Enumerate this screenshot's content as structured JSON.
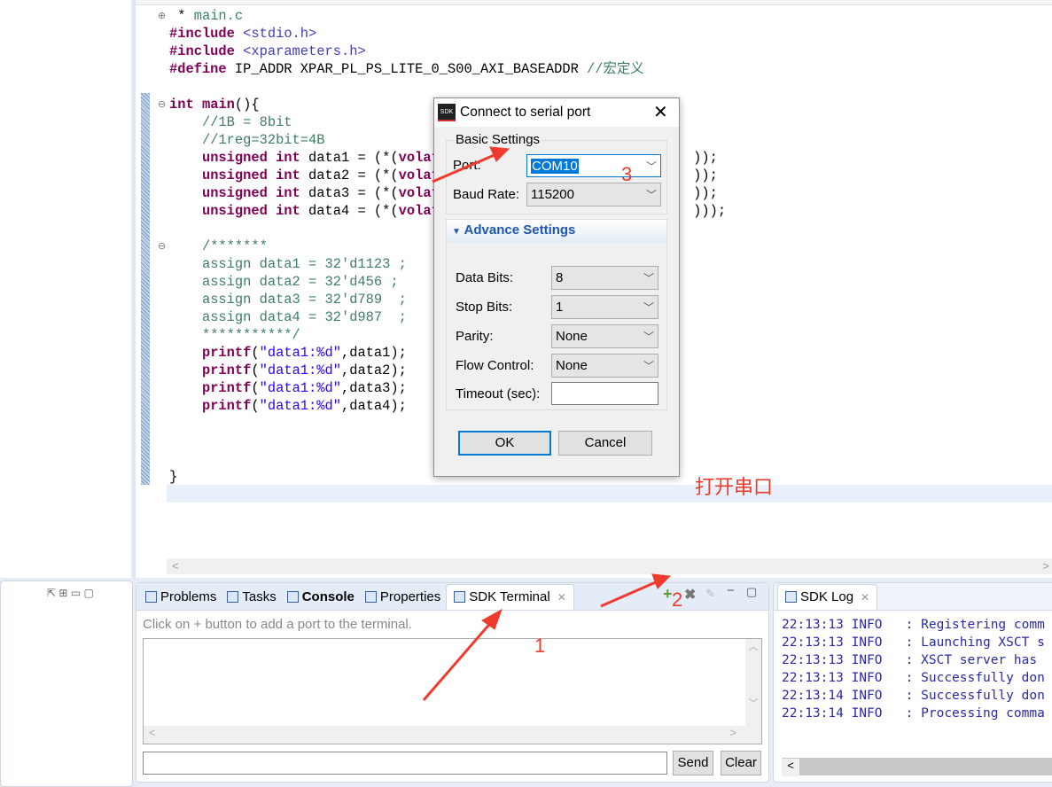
{
  "editor": {
    "code_lines": [
      [
        {
          "c": "pl",
          "t": " * "
        },
        {
          "c": "cm",
          "t": "main.c"
        },
        {
          "c": "pl",
          "t": " "
        }
      ],
      [
        {
          "c": "kw",
          "t": "#include"
        },
        {
          "c": "pl",
          "t": " "
        },
        {
          "c": "inc",
          "t": "<stdio.h>"
        }
      ],
      [
        {
          "c": "kw",
          "t": "#include"
        },
        {
          "c": "pl",
          "t": " "
        },
        {
          "c": "inc",
          "t": "<xparameters.h>"
        }
      ],
      [
        {
          "c": "kw",
          "t": "#define"
        },
        {
          "c": "pl",
          "t": " IP_ADDR XPAR_PL_PS_LITE_0_S00_AXI_BASEADDR "
        },
        {
          "c": "cm",
          "t": "//宏定义"
        }
      ],
      [],
      [
        {
          "c": "kw",
          "t": "int"
        },
        {
          "c": "pl",
          "t": " "
        },
        {
          "c": "kw",
          "t": "main"
        },
        {
          "c": "pl",
          "t": "(){"
        }
      ],
      [
        {
          "c": "pl",
          "t": "    "
        },
        {
          "c": "cm",
          "t": "//1B = 8bit"
        }
      ],
      [
        {
          "c": "pl",
          "t": "    "
        },
        {
          "c": "cm",
          "t": "//1reg=32bit=4B"
        }
      ],
      [
        {
          "c": "pl",
          "t": "    "
        },
        {
          "c": "kw",
          "t": "unsigned int"
        },
        {
          "c": "pl",
          "t": " data1 = (*("
        },
        {
          "c": "kw",
          "t": "volati"
        },
        {
          "c": "pl",
          "t": "                              ));"
        }
      ],
      [
        {
          "c": "pl",
          "t": "    "
        },
        {
          "c": "kw",
          "t": "unsigned int"
        },
        {
          "c": "pl",
          "t": " data2 = (*("
        },
        {
          "c": "kw",
          "t": "volati"
        },
        {
          "c": "pl",
          "t": "                              ));"
        }
      ],
      [
        {
          "c": "pl",
          "t": "    "
        },
        {
          "c": "kw",
          "t": "unsigned int"
        },
        {
          "c": "pl",
          "t": " data3 = (*("
        },
        {
          "c": "kw",
          "t": "volati"
        },
        {
          "c": "pl",
          "t": "                              ));"
        }
      ],
      [
        {
          "c": "pl",
          "t": "    "
        },
        {
          "c": "kw",
          "t": "unsigned int"
        },
        {
          "c": "pl",
          "t": " data4 = (*("
        },
        {
          "c": "kw",
          "t": "volati"
        },
        {
          "c": "pl",
          "t": "                              )));"
        }
      ],
      [],
      [
        {
          "c": "pl",
          "t": "    "
        },
        {
          "c": "cm",
          "t": "/*******"
        }
      ],
      [
        {
          "c": "pl",
          "t": "    "
        },
        {
          "c": "cm",
          "t": "assign data1 = 32'd1123 ;"
        }
      ],
      [
        {
          "c": "pl",
          "t": "    "
        },
        {
          "c": "cm",
          "t": "assign data2 = 32'd456 ;"
        }
      ],
      [
        {
          "c": "pl",
          "t": "    "
        },
        {
          "c": "cm",
          "t": "assign data3 = 32'd789  ;"
        }
      ],
      [
        {
          "c": "pl",
          "t": "    "
        },
        {
          "c": "cm",
          "t": "assign data4 = 32'd987  ;"
        }
      ],
      [
        {
          "c": "pl",
          "t": "    "
        },
        {
          "c": "cm",
          "t": "***********/"
        }
      ],
      [
        {
          "c": "pl",
          "t": "    "
        },
        {
          "c": "kw",
          "t": "printf"
        },
        {
          "c": "pl",
          "t": "("
        },
        {
          "c": "str",
          "t": "\"data1:%d\""
        },
        {
          "c": "pl",
          "t": ",data1);"
        }
      ],
      [
        {
          "c": "pl",
          "t": "    "
        },
        {
          "c": "kw",
          "t": "printf"
        },
        {
          "c": "pl",
          "t": "("
        },
        {
          "c": "str",
          "t": "\"data1:%d\""
        },
        {
          "c": "pl",
          "t": ",data2);"
        }
      ],
      [
        {
          "c": "pl",
          "t": "    "
        },
        {
          "c": "kw",
          "t": "printf"
        },
        {
          "c": "pl",
          "t": "("
        },
        {
          "c": "str",
          "t": "\"data1:%d\""
        },
        {
          "c": "pl",
          "t": ",data3);"
        }
      ],
      [
        {
          "c": "pl",
          "t": "    "
        },
        {
          "c": "kw",
          "t": "printf"
        },
        {
          "c": "pl",
          "t": "("
        },
        {
          "c": "str",
          "t": "\"data1:%d\""
        },
        {
          "c": "pl",
          "t": ",data4);"
        }
      ],
      [],
      [],
      [],
      [
        {
          "c": "pl",
          "t": "}"
        }
      ]
    ]
  },
  "dialog": {
    "title": "Connect to serial port",
    "logo": "SDK",
    "basic_group": "Basic Settings",
    "port_label": "Port:",
    "port_value": "COM10",
    "baud_label": "Baud Rate:",
    "baud_value": "115200",
    "advance_header": "Advance Settings",
    "data_bits_label": "Data Bits:",
    "data_bits_value": "8",
    "stop_bits_label": "Stop Bits:",
    "stop_bits_value": "1",
    "parity_label": "Parity:",
    "parity_value": "None",
    "flow_label": "Flow Control:",
    "flow_value": "None",
    "timeout_label": "Timeout (sec):",
    "timeout_value": "",
    "ok": "OK",
    "cancel": "Cancel"
  },
  "terminal": {
    "tabs": [
      "Problems",
      "Tasks",
      "Console",
      "Properties",
      "SDK Terminal"
    ],
    "hint": "Click on + button to add a port to the terminal.",
    "input_value": "",
    "send": "Send",
    "clear": "Clear"
  },
  "log": {
    "tab": "SDK Log",
    "lines": [
      "22:13:13 INFO   : Registering comm",
      "22:13:13 INFO   : Launching XSCT s",
      "22:13:13 INFO   : XSCT server has ",
      "22:13:13 INFO   : Successfully don",
      "22:13:14 INFO   : Successfully don",
      "22:13:14 INFO   : Processing comma"
    ]
  },
  "annotations": {
    "step1": "1",
    "step2": "2",
    "step3": "3",
    "note": "打开串口",
    "color": "#f03a2e"
  }
}
